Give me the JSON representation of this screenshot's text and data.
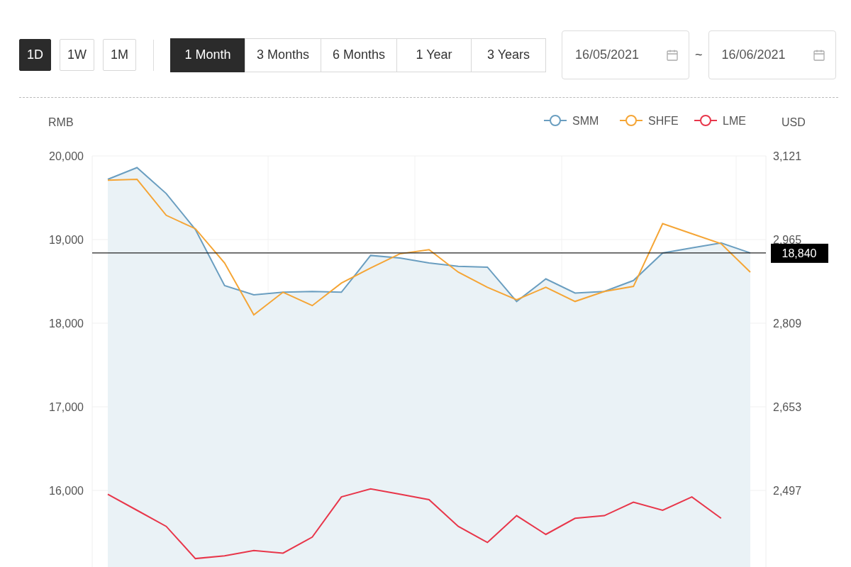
{
  "intervals": [
    {
      "label": "1D",
      "selected": true
    },
    {
      "label": "1W",
      "selected": false
    },
    {
      "label": "1M",
      "selected": false
    }
  ],
  "periods": [
    {
      "label": "1 Month",
      "selected": true
    },
    {
      "label": "3 Months",
      "selected": false
    },
    {
      "label": "6 Months",
      "selected": false
    },
    {
      "label": "1 Year",
      "selected": false
    },
    {
      "label": "3 Years",
      "selected": false
    }
  ],
  "date_range": {
    "start": "16/05/2021",
    "separator": "~",
    "end": "16/06/2021"
  },
  "chart": {
    "chart_data": {
      "type": "line",
      "grid": true,
      "legend": "top-right",
      "ylabel": "RMB",
      "y2label": "USD",
      "ylim": [
        15000,
        20000
      ],
      "yticks": [
        {
          "value": 20000,
          "label": "20,000"
        },
        {
          "value": 19000,
          "label": "19,000"
        },
        {
          "value": 18000,
          "label": "18,000"
        },
        {
          "value": 17000,
          "label": "17,000"
        },
        {
          "value": 16000,
          "label": "16,000"
        }
      ],
      "y2lim": [
        2341,
        3121
      ],
      "y2ticks": [
        {
          "value": 3121,
          "label": "3,121"
        },
        {
          "value": 2965,
          "label": "2,965"
        },
        {
          "value": 2809,
          "label": "2,809"
        },
        {
          "value": 2653,
          "label": "2,653"
        },
        {
          "value": 2497,
          "label": "2,497"
        }
      ],
      "series": [
        {
          "name": "SMM",
          "color": "#6a9ec0",
          "type": "area",
          "values": [
            19720,
            19860,
            19550,
            19120,
            18450,
            18340,
            18370,
            18380,
            18370,
            18810,
            18780,
            18720,
            18680,
            18670,
            18260,
            18530,
            18360,
            18380,
            18510,
            18840,
            18900,
            18960,
            18840
          ]
        },
        {
          "name": "SHFE",
          "color": "#f5a535",
          "values": [
            19710,
            19720,
            19290,
            19130,
            18720,
            18100,
            18370,
            18210,
            18480,
            18660,
            18830,
            18880,
            18610,
            18430,
            18280,
            18430,
            18260,
            18380,
            18440,
            19190,
            19070,
            18950,
            18610
          ]
        },
        {
          "name": "LME",
          "color": "#e8364a",
          "axis": "y2",
          "values": [
            2490,
            2460,
            2430,
            2370,
            2375,
            2385,
            2380,
            2410,
            2485,
            2500,
            2490,
            2480,
            2430,
            2400,
            2450,
            2415,
            2445,
            2450,
            2475,
            2460,
            2485,
            2445,
            null
          ]
        }
      ],
      "ref_lines": [
        {
          "axis": "y",
          "value": 18840,
          "label": "18,840"
        }
      ]
    }
  }
}
